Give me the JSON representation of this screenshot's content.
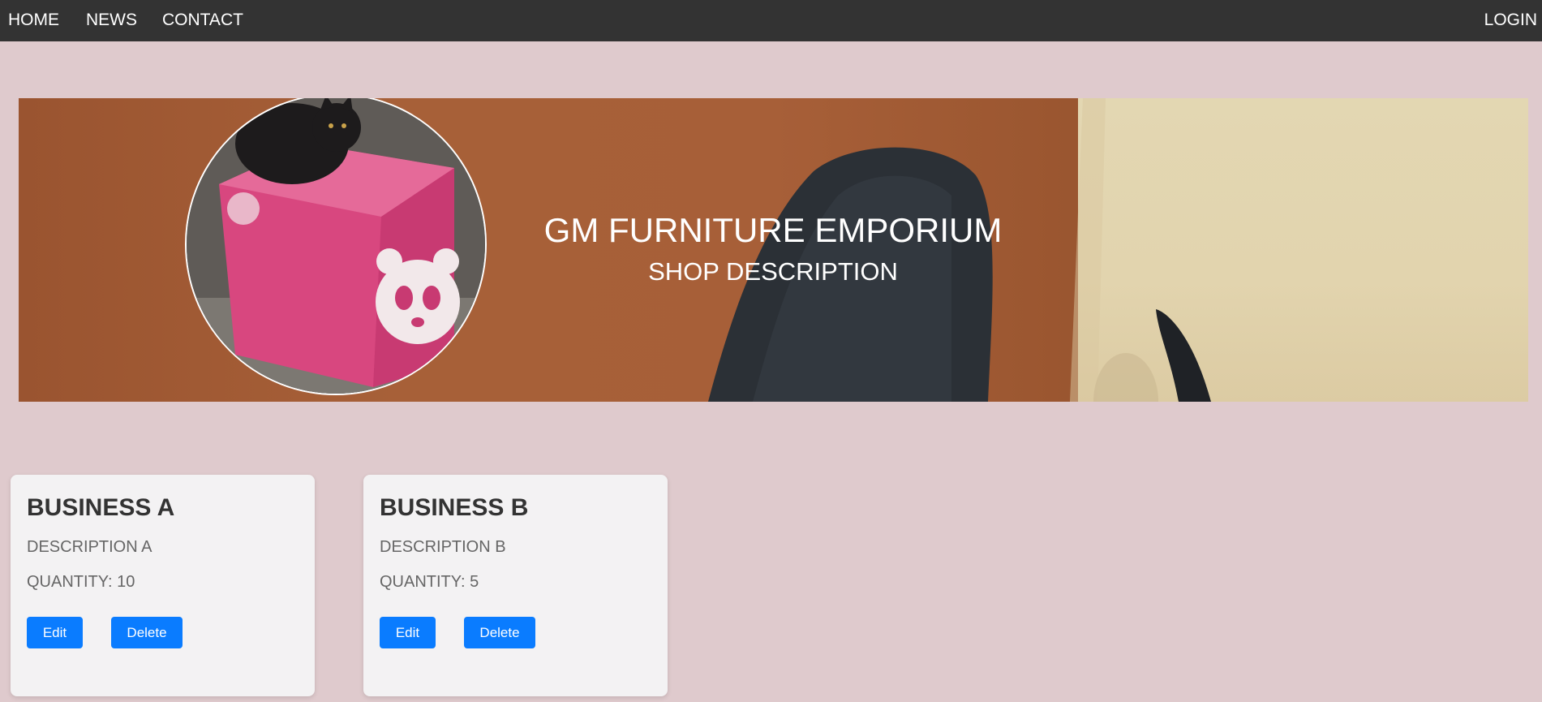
{
  "nav": {
    "links": [
      {
        "label": "HOME"
      },
      {
        "label": "NEWS"
      },
      {
        "label": "CONTACT"
      }
    ],
    "login_label": "LOGIN"
  },
  "banner": {
    "title": "GM FURNITURE EMPORIUM",
    "subtitle": "SHOP DESCRIPTION"
  },
  "businesses": [
    {
      "name": "BUSINESS A",
      "description": "DESCRIPTION A",
      "quantity_text": "QUANTITY: 10",
      "edit_label": "Edit",
      "delete_label": "Delete"
    },
    {
      "name": "BUSINESS B",
      "description": "DESCRIPTION B",
      "quantity_text": "QUANTITY: 5",
      "edit_label": "Edit",
      "delete_label": "Delete"
    }
  ],
  "colors": {
    "page_background": "#dfcacd",
    "navbar": "#333333",
    "button": "#0a7cff",
    "card": "#f3f2f3"
  }
}
